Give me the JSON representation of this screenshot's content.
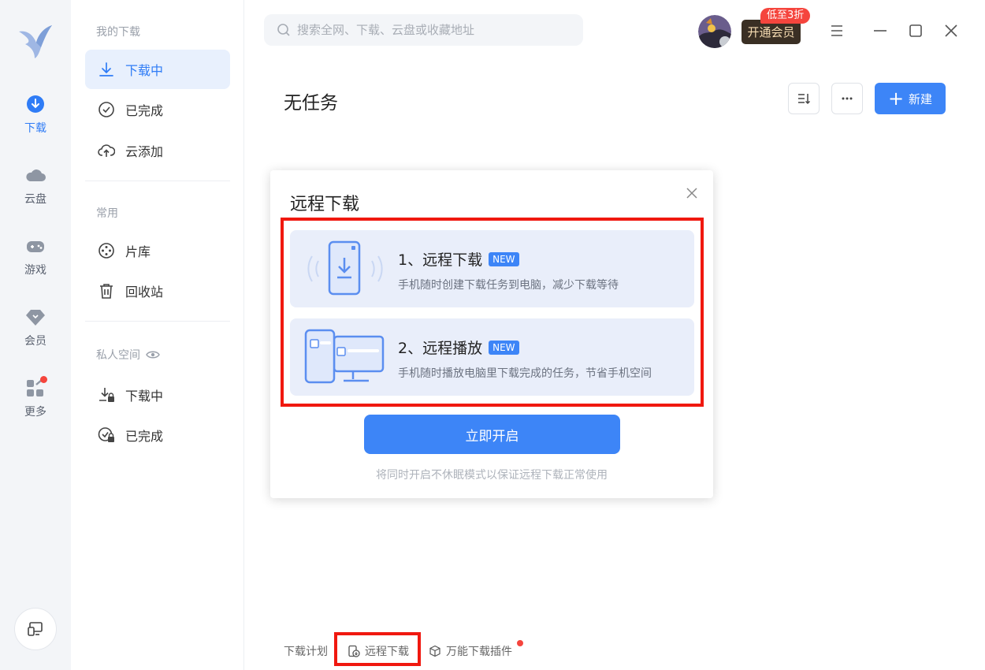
{
  "nav": {
    "items": [
      {
        "label": "下载",
        "icon": "download-circle-icon",
        "active": true
      },
      {
        "label": "云盘",
        "icon": "cloud-icon"
      },
      {
        "label": "游戏",
        "icon": "gamepad-icon"
      },
      {
        "label": "会员",
        "icon": "diamond-icon"
      },
      {
        "label": "更多",
        "icon": "apps-grid-icon",
        "badge_dot": true
      }
    ]
  },
  "sidebar": {
    "my_downloads_header": "我的下载",
    "my_downloads": [
      {
        "label": "下载中",
        "icon": "download-arrow-icon",
        "active": true
      },
      {
        "label": "已完成",
        "icon": "check-circle-icon"
      },
      {
        "label": "云添加",
        "icon": "cloud-upload-icon"
      }
    ],
    "common_header": "常用",
    "common": [
      {
        "label": "片库",
        "icon": "film-reel-icon"
      },
      {
        "label": "回收站",
        "icon": "trash-icon"
      }
    ],
    "private_header": "私人空间",
    "private": [
      {
        "label": "下载中",
        "icon": "download-lock-icon"
      },
      {
        "label": "已完成",
        "icon": "check-lock-icon"
      }
    ]
  },
  "topbar": {
    "search_placeholder": "搜索全网、下载、云盘或收藏地址",
    "vip_button": "开通会员",
    "vip_badge": "低至3折"
  },
  "header": {
    "title": "无任务",
    "new_button": "新建"
  },
  "modal": {
    "title": "远程下载",
    "features": [
      {
        "title": "1、远程下载",
        "tag": "NEW",
        "desc": "手机随时创建下载任务到电脑，减少下载等待",
        "icon": "phone-download-icon"
      },
      {
        "title": "2、远程播放",
        "tag": "NEW",
        "desc": "手机随时播放电脑里下载完成的任务，节省手机空间",
        "icon": "phone-monitor-icon"
      }
    ],
    "primary_button": "立即开启",
    "note": "将同时开启不休眠模式以保证远程下载正常使用"
  },
  "footer": {
    "links": [
      {
        "label": "下载计划"
      },
      {
        "label": "远程下载",
        "icon": "remote-download-icon"
      },
      {
        "label": "万能下载插件",
        "icon": "cube-icon",
        "badge_dot": true
      }
    ]
  },
  "colors": {
    "accent": "#3d85f7",
    "highlight_red": "#f0180f",
    "badge_red": "#f5453d"
  }
}
